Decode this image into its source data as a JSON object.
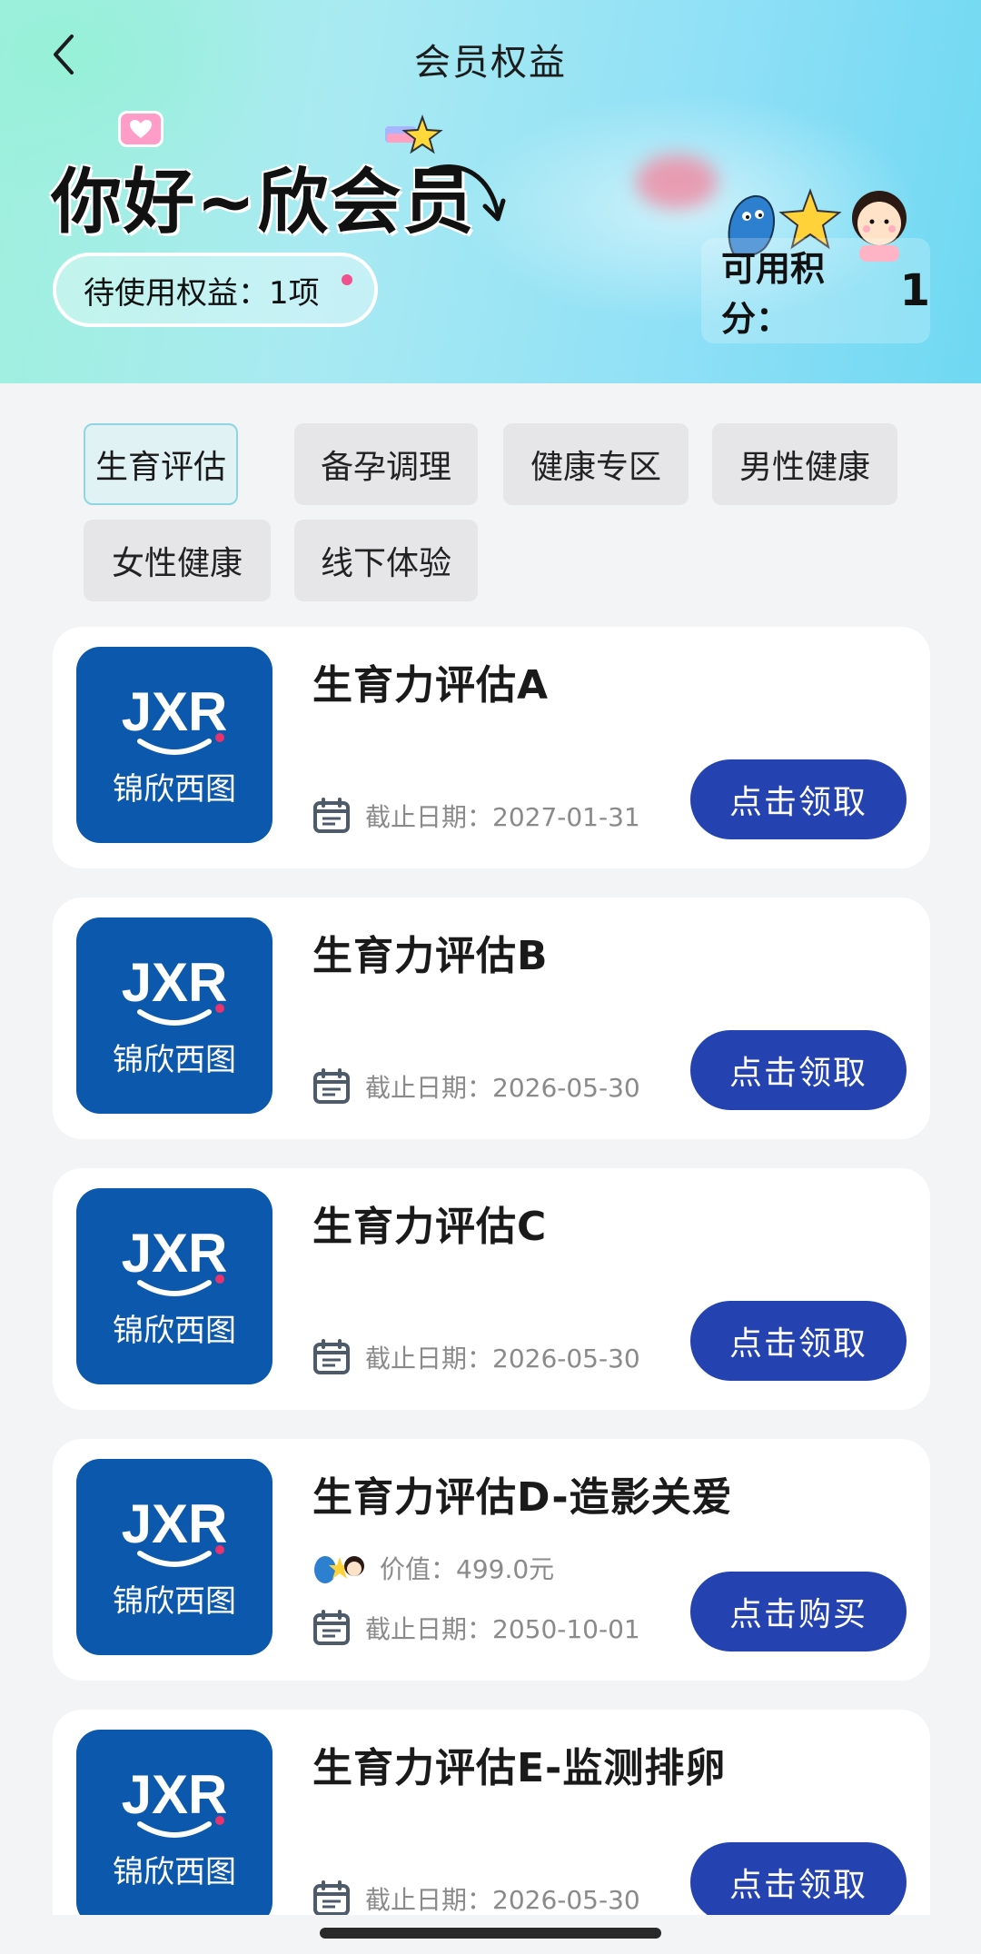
{
  "header": {
    "back_label": "",
    "title": "会员权益",
    "greeting": "你好~欣会员",
    "pending_benefits": "待使用权益：1项",
    "points_label": "可用积分：",
    "points_value": "1"
  },
  "tabs": [
    {
      "label": "生育评估",
      "active": true
    },
    {
      "label": "备孕调理",
      "active": false
    },
    {
      "label": "健康专区",
      "active": false
    },
    {
      "label": "男性健康",
      "active": false
    },
    {
      "label": "女性健康",
      "active": false
    },
    {
      "label": "线下体验",
      "active": false
    }
  ],
  "logo": {
    "mark": "JXR",
    "name": "锦欣西图"
  },
  "cards": [
    {
      "title": "生育力评估A",
      "deadline": "截止日期：2027-01-31",
      "value": "",
      "button": "点击领取"
    },
    {
      "title": "生育力评估B",
      "deadline": "截止日期：2026-05-30",
      "value": "",
      "button": "点击领取"
    },
    {
      "title": "生育力评估C",
      "deadline": "截止日期：2026-05-30",
      "value": "",
      "button": "点击领取"
    },
    {
      "title": "生育力评估D-造影关爱",
      "deadline": "截止日期：2050-10-01",
      "value": "价值：499.0元",
      "button": "点击购买"
    },
    {
      "title": "生育力评估E-监测排卵",
      "deadline": "截止日期：2026-05-30",
      "value": "",
      "button": "点击领取"
    }
  ],
  "colors": {
    "primary_button": "#2443b0",
    "logo_bg": "#0b58ad",
    "logo_accent": "#e8336d",
    "active_tab_border": "#8fd6e2"
  }
}
